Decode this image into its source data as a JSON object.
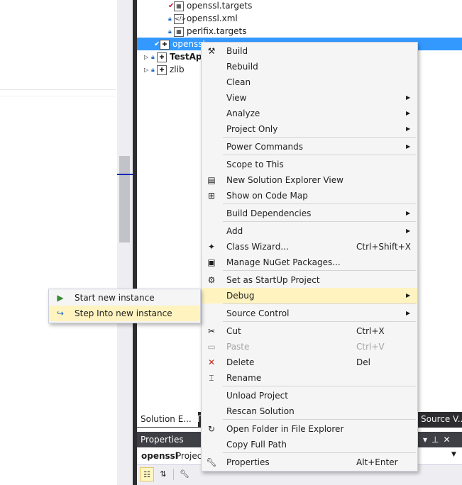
{
  "solution_explorer": {
    "rows": [
      {
        "label": "openssl.targets"
      },
      {
        "label": "openssl.xml"
      },
      {
        "label": "perlfix.targets"
      },
      {
        "label": "openssl"
      },
      {
        "label": "TestAp"
      },
      {
        "label": "zlib"
      }
    ]
  },
  "tabs": {
    "solution": "Solution E...",
    "team": "T",
    "source": "Source V..."
  },
  "properties": {
    "title": "Properties",
    "object_name": "openssl",
    "object_type": "Project"
  },
  "context_menu": [
    {
      "label": "Build",
      "icon": "build-icon"
    },
    {
      "label": "Rebuild"
    },
    {
      "label": "Clean"
    },
    {
      "label": "View",
      "submenu": true
    },
    {
      "label": "Analyze",
      "submenu": true
    },
    {
      "label": "Project Only",
      "submenu": true
    },
    {
      "label": "Power Commands",
      "submenu": true
    },
    {
      "label": "Scope to This"
    },
    {
      "label": "New Solution Explorer View",
      "icon": "new-view-icon"
    },
    {
      "label": "Show on Code Map",
      "icon": "code-map-icon"
    },
    {
      "label": "Build Dependencies",
      "submenu": true
    },
    {
      "label": "Add",
      "submenu": true
    },
    {
      "label": "Class Wizard...",
      "shortcut": "Ctrl+Shift+X",
      "icon": "class-wizard-icon"
    },
    {
      "label": "Manage NuGet Packages...",
      "icon": "nuget-icon"
    },
    {
      "label": "Set as StartUp Project",
      "icon": "gear-icon"
    },
    {
      "label": "Debug",
      "submenu": true,
      "highlighted": true
    },
    {
      "label": "Source Control",
      "submenu": true
    },
    {
      "label": "Cut",
      "shortcut": "Ctrl+X",
      "icon": "scissors-icon"
    },
    {
      "label": "Paste",
      "shortcut": "Ctrl+V",
      "icon": "paste-icon",
      "disabled": true
    },
    {
      "label": "Delete",
      "shortcut": "Del",
      "icon": "delete-icon"
    },
    {
      "label": "Rename",
      "icon": "rename-icon"
    },
    {
      "label": "Unload Project"
    },
    {
      "label": "Rescan Solution"
    },
    {
      "label": "Open Folder in File Explorer",
      "icon": "open-folder-icon"
    },
    {
      "label": "Copy Full Path"
    },
    {
      "label": "Properties",
      "shortcut": "Alt+Enter",
      "icon": "wrench-icon"
    }
  ],
  "debug_submenu": [
    {
      "label": "Start new instance",
      "icon": "play-icon"
    },
    {
      "label": "Step Into new instance",
      "icon": "step-into-icon",
      "highlighted": true
    }
  ],
  "colors": {
    "selection": "#3399ff",
    "menu_highlight": "#fff3c0",
    "menu_background": "#f5f5f5",
    "panel_header": "#3f3f46"
  }
}
